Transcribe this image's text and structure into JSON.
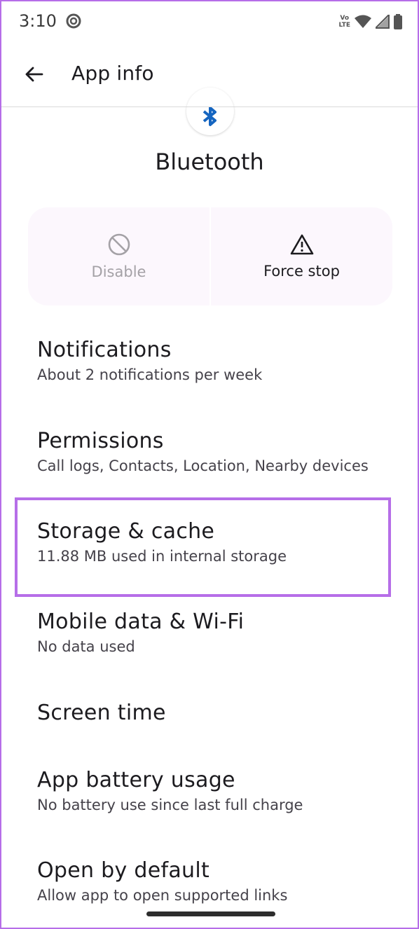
{
  "status_bar": {
    "time": "3:10",
    "volte_top": "Vo",
    "volte_bottom": "LTE"
  },
  "app_bar": {
    "title": "App info"
  },
  "app": {
    "name": "Bluetooth",
    "icon": "bluetooth-icon",
    "icon_color": "#1565c0"
  },
  "actions": {
    "disable_label": "Disable",
    "force_stop_label": "Force stop"
  },
  "items": [
    {
      "title": "Notifications",
      "subtitle": "About 2 notifications per week"
    },
    {
      "title": "Permissions",
      "subtitle": "Call logs, Contacts, Location, Nearby devices"
    },
    {
      "title": "Storage & cache",
      "subtitle": "11.88 MB used in internal storage"
    },
    {
      "title": "Mobile data & Wi-Fi",
      "subtitle": "No data used"
    },
    {
      "title": "Screen time",
      "subtitle": ""
    },
    {
      "title": "App battery usage",
      "subtitle": "No battery use since last full charge"
    },
    {
      "title": "Open by default",
      "subtitle": "Allow app to open supported links"
    }
  ],
  "colors": {
    "highlight": "#b66ee8",
    "card_bg": "#fcf7fd"
  }
}
